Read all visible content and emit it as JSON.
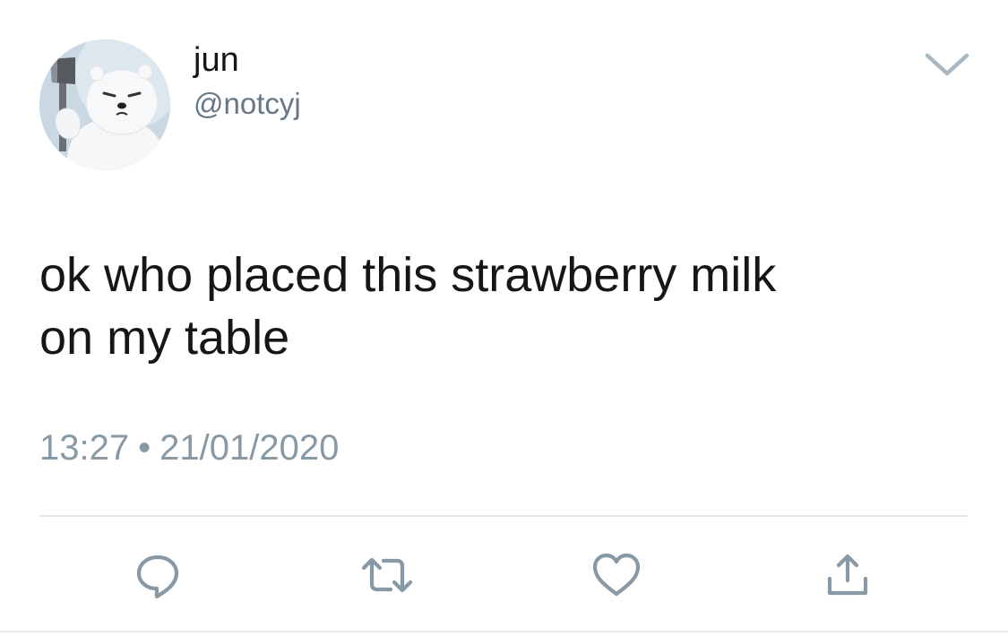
{
  "user": {
    "display_name": "jun",
    "handle": "@notcyj",
    "avatar": "avatar-image"
  },
  "tweet": {
    "text": "ok who placed this strawberry milk\non my table",
    "time": "13:27",
    "separator": "•",
    "date": "21/01/2020"
  },
  "menu": {
    "icon": "chevron-down-icon"
  },
  "actions": [
    {
      "name": "reply",
      "icon": "reply-icon"
    },
    {
      "name": "retweet",
      "icon": "retweet-icon"
    },
    {
      "name": "like",
      "icon": "heart-icon"
    },
    {
      "name": "share",
      "icon": "share-icon"
    }
  ],
  "colors": {
    "text_primary": "#14171a",
    "text_secondary": "#657786",
    "timestamp": "#8899a6",
    "icon": "#8899a6",
    "divider": "#e1e8ed",
    "background": "#ffffff"
  }
}
